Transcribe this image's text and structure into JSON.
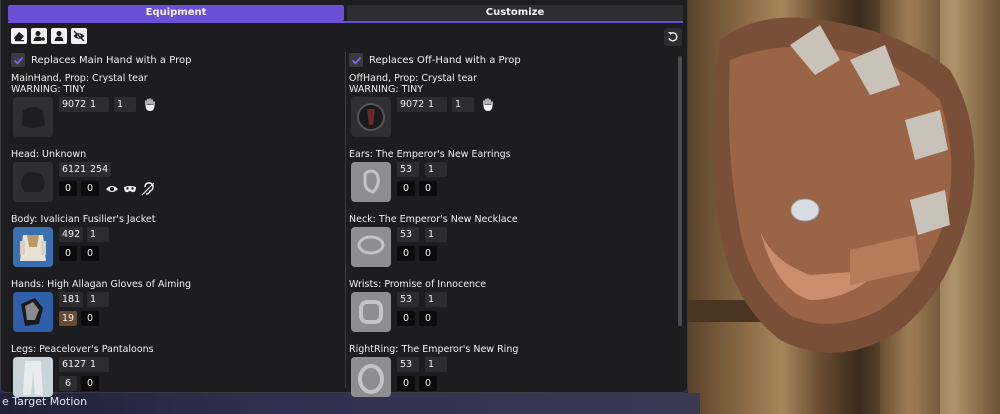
{
  "tabs": [
    {
      "label": "Equipment",
      "active": true
    },
    {
      "label": "Customize",
      "active": false
    }
  ],
  "toolbar": {
    "icons": [
      "eraser-icon",
      "user-settings-icon",
      "user-icon",
      "eye-slash-icon"
    ],
    "reset_icon": "undo-icon"
  },
  "background": {
    "bottom_text": "e Target Motion"
  },
  "left": {
    "prop_label": "Replaces Main Hand with a Prop",
    "prop_checked": true,
    "slots": [
      {
        "title": "MainHand, Prop: Crystal tear",
        "warning": "WARNING: TINY",
        "values": [
          "9072",
          "1",
          "1"
        ],
        "icon": "glove-icon",
        "extra_icon": "hand-icon"
      },
      {
        "title": "Head: Unknown",
        "values": [
          "6121",
          "254"
        ],
        "dyes": [
          "0",
          "0"
        ],
        "icon": "helmet-icon",
        "extra_icons": [
          "eye-icon",
          "mask-icon",
          "ear-slash-icon"
        ]
      },
      {
        "title": "Body: Ivalician Fusilier's Jacket",
        "values": [
          "492",
          "1"
        ],
        "dyes": [
          "0",
          "0"
        ],
        "icon": "jacket-icon"
      },
      {
        "title": "Hands: High Allagan Gloves of Aiming",
        "values": [
          "181",
          "1"
        ],
        "dyes": [
          "19",
          "0"
        ],
        "icon": "gauntlet-icon"
      },
      {
        "title": "Legs: Peacelover's Pantaloons",
        "values": [
          "6127",
          "1"
        ],
        "dyes": [
          "6",
          "0"
        ],
        "icon": "pants-icon"
      }
    ]
  },
  "right": {
    "prop_label": "Replaces Off-Hand with a Prop",
    "prop_checked": true,
    "slots": [
      {
        "title": "OffHand, Prop: Crystal tear",
        "warning": "WARNING: TINY",
        "values": [
          "9072",
          "1",
          "1"
        ],
        "icon": "shield-icon",
        "extra_icon": "hand-icon"
      },
      {
        "title": "Ears: The Emperor's New Earrings",
        "values": [
          "53",
          "1"
        ],
        "dyes": [
          "0",
          "0"
        ],
        "icon": "earring-icon"
      },
      {
        "title": "Neck: The Emperor's New Necklace",
        "values": [
          "53",
          "1"
        ],
        "dyes": [
          "0",
          "0"
        ],
        "icon": "necklace-icon"
      },
      {
        "title": "Wrists: Promise of Innocence",
        "values": [
          "53",
          "1"
        ],
        "dyes": [
          "0",
          "0"
        ],
        "icon": "bracelet-icon"
      },
      {
        "title": "RightRing: The Emperor's New Ring",
        "values": [
          "53",
          "1"
        ],
        "dyes": [
          "0",
          "0"
        ],
        "icon": "ring-icon"
      }
    ]
  },
  "colors": {
    "accent": "#6b4fd6",
    "panel": "#1d1d1f",
    "dye_brown": "#6a4a33"
  }
}
